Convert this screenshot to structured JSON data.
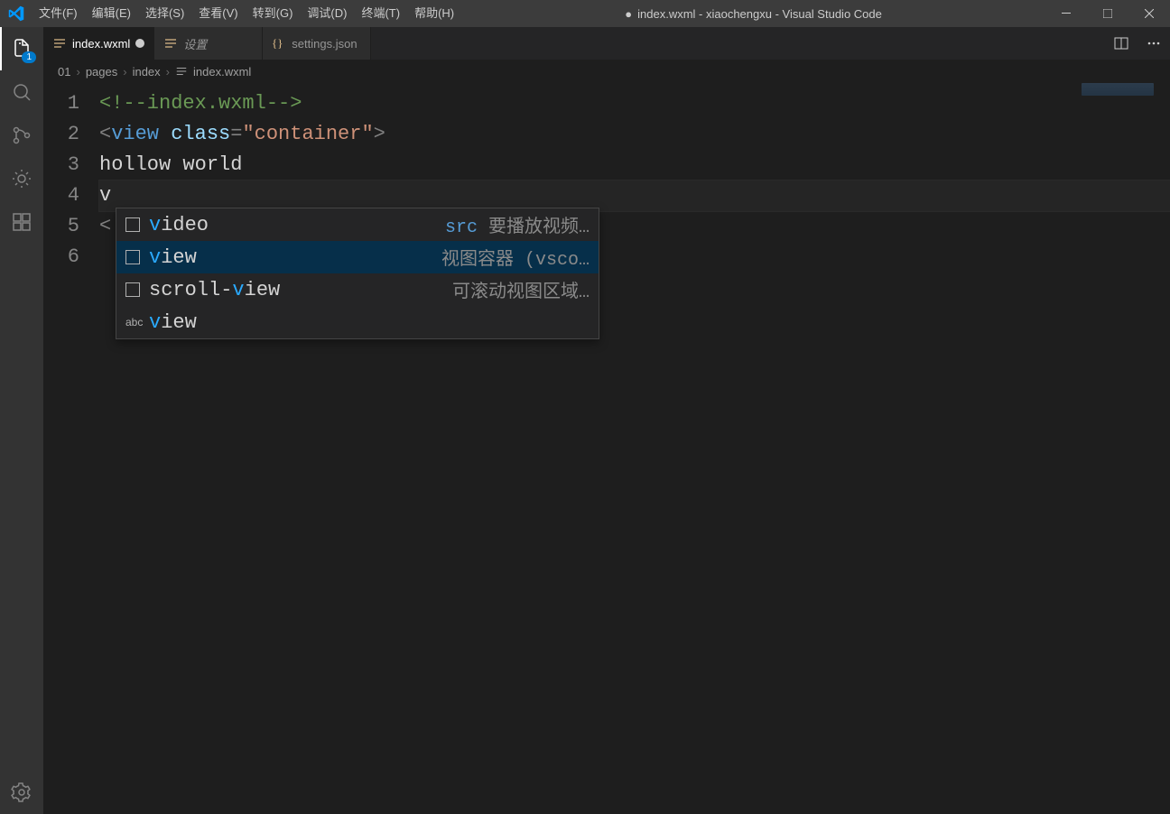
{
  "window": {
    "title_prefix": "●",
    "title": "index.wxml - xiaochengxu - Visual Studio Code"
  },
  "menu": [
    "文件(F)",
    "编辑(E)",
    "选择(S)",
    "查看(V)",
    "转到(G)",
    "调试(D)",
    "终端(T)",
    "帮助(H)"
  ],
  "activity": {
    "explorer_badge": "1"
  },
  "tabs": [
    {
      "label": "index.wxml",
      "active": true,
      "dirty": true,
      "icon": "lines"
    },
    {
      "label": "设置",
      "active": false,
      "italic": true,
      "icon": "lines"
    },
    {
      "label": "settings.json",
      "active": false,
      "icon": "braces"
    }
  ],
  "breadcrumbs": [
    "01",
    "pages",
    "index",
    "index.wxml"
  ],
  "code": {
    "lines": [
      {
        "n": "1",
        "segments": [
          {
            "t": "<!--index.wxml-->",
            "cls": "tok-comment"
          }
        ]
      },
      {
        "n": "2",
        "segments": [
          {
            "t": "<",
            "cls": "tok-punct"
          },
          {
            "t": "view",
            "cls": "tok-tag"
          },
          {
            "t": " ",
            "cls": "tok-text"
          },
          {
            "t": "class",
            "cls": "tok-attr"
          },
          {
            "t": "=",
            "cls": "tok-punct"
          },
          {
            "t": "\"container\"",
            "cls": "tok-string"
          },
          {
            "t": ">",
            "cls": "tok-punct"
          }
        ]
      },
      {
        "n": "3",
        "segments": [
          {
            "t": "hollow world",
            "cls": "tok-text"
          }
        ]
      },
      {
        "n": "4",
        "current": true,
        "segments": [
          {
            "t": "v",
            "cls": "tok-text"
          }
        ]
      },
      {
        "n": "5",
        "segments": [
          {
            "t": "<",
            "cls": "tok-punct"
          }
        ]
      },
      {
        "n": "6",
        "segments": []
      }
    ]
  },
  "suggest": {
    "items": [
      {
        "kind": "element",
        "match": "v",
        "rest": "ideo",
        "detail_pre": "src",
        "detail": "要播放视频…"
      },
      {
        "kind": "element",
        "match": "v",
        "rest": "iew",
        "detail_pre": "",
        "detail": "视图容器 (vsco…",
        "selected": true
      },
      {
        "kind": "element",
        "match_mid_pre": "scroll-",
        "match": "v",
        "rest": "iew",
        "detail_pre": "",
        "detail": "可滚动视图区域…"
      },
      {
        "kind": "text",
        "match": "v",
        "rest": "iew",
        "detail_pre": "",
        "detail": ""
      }
    ]
  }
}
